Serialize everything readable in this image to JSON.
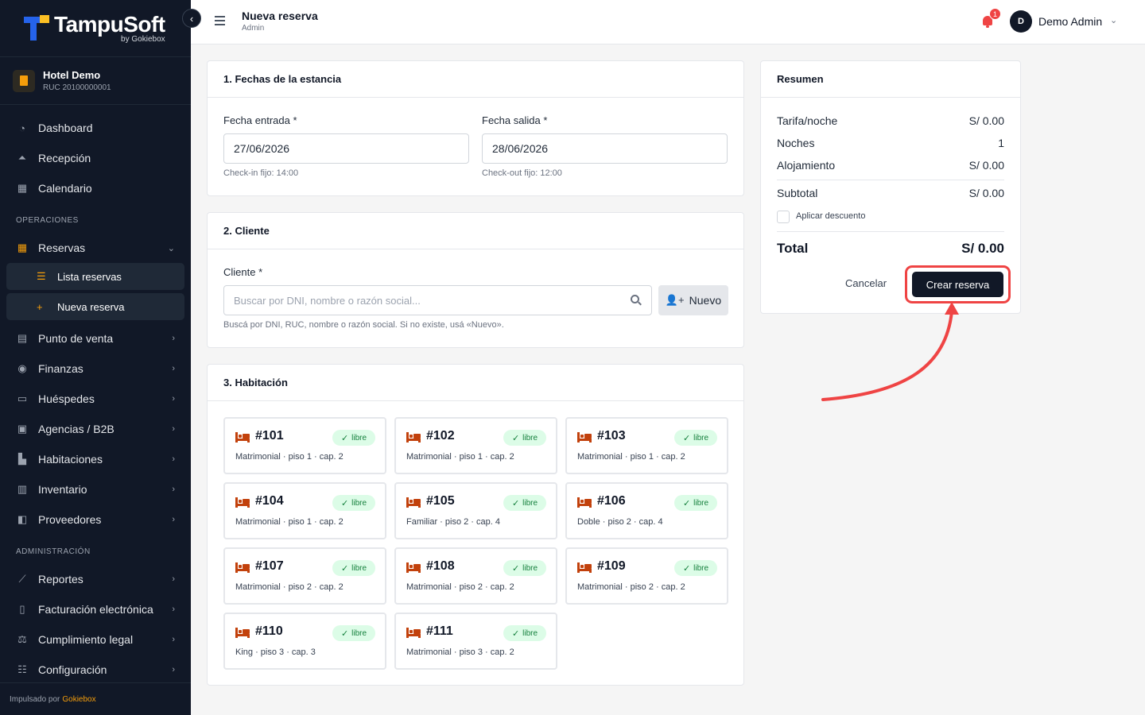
{
  "brand": {
    "name": "TampuSoft",
    "sub": "by Gokiebox"
  },
  "hotel": {
    "name": "Hotel Demo",
    "ruc": "RUC 20100000001"
  },
  "nav": {
    "dashboard": "Dashboard",
    "recepcion": "Recepción",
    "calendario": "Calendario",
    "section_operaciones": "OPERACIONES",
    "reservas": "Reservas",
    "lista_reservas": "Lista reservas",
    "nueva_reserva": "Nueva reserva",
    "punto_venta": "Punto de venta",
    "finanzas": "Finanzas",
    "huespedes": "Huéspedes",
    "agencias": "Agencias / B2B",
    "habitaciones": "Habitaciones",
    "inventario": "Inventario",
    "proveedores": "Proveedores",
    "section_admin": "ADMINISTRACIÓN",
    "reportes": "Reportes",
    "facturacion": "Facturación electrónica",
    "cumplimiento": "Cumplimiento legal",
    "configuracion": "Configuración"
  },
  "footer": {
    "prefix": "Impulsado por",
    "brand": "Gokiebox"
  },
  "topbar": {
    "title": "Nueva reserva",
    "subtitle": "Admin",
    "notifications": "1",
    "user_initial": "D",
    "user_name": "Demo Admin"
  },
  "fechas": {
    "heading": "1. Fechas de la estancia",
    "entrada_label": "Fecha entrada *",
    "entrada_value": "27/06/2026",
    "entrada_hint": "Check-in fijo: 14:00",
    "salida_label": "Fecha salida *",
    "salida_value": "28/06/2026",
    "salida_hint": "Check-out fijo: 12:00"
  },
  "cliente": {
    "heading": "2. Cliente",
    "label": "Cliente *",
    "placeholder": "Buscar por DNI, nombre o razón social...",
    "new_button": "Nuevo",
    "hint": "Buscá por DNI, RUC, nombre o razón social. Si no existe, usá «Nuevo»."
  },
  "habitacion": {
    "heading": "3. Habitación",
    "rooms": [
      {
        "number": "#101",
        "status": "libre",
        "info": "Matrimonial · piso 1 · cap. 2"
      },
      {
        "number": "#102",
        "status": "libre",
        "info": "Matrimonial · piso 1 · cap. 2"
      },
      {
        "number": "#103",
        "status": "libre",
        "info": "Matrimonial · piso 1 · cap. 2"
      },
      {
        "number": "#104",
        "status": "libre",
        "info": "Matrimonial · piso 1 · cap. 2"
      },
      {
        "number": "#105",
        "status": "libre",
        "info": "Familiar · piso 2 · cap. 4"
      },
      {
        "number": "#106",
        "status": "libre",
        "info": "Doble · piso 2 · cap. 4"
      },
      {
        "number": "#107",
        "status": "libre",
        "info": "Matrimonial · piso 2 · cap. 2"
      },
      {
        "number": "#108",
        "status": "libre",
        "info": "Matrimonial · piso 2 · cap. 2"
      },
      {
        "number": "#109",
        "status": "libre",
        "info": "Matrimonial · piso 2 · cap. 2"
      },
      {
        "number": "#110",
        "status": "libre",
        "info": "King · piso 3 · cap. 3"
      },
      {
        "number": "#111",
        "status": "libre",
        "info": "Matrimonial · piso 3 · cap. 2"
      }
    ]
  },
  "resumen": {
    "heading": "Resumen",
    "tarifa_label": "Tarifa/noche",
    "tarifa_value": "S/ 0.00",
    "noches_label": "Noches",
    "noches_value": "1",
    "alojamiento_label": "Alojamiento",
    "alojamiento_value": "S/ 0.00",
    "subtotal_label": "Subtotal",
    "subtotal_value": "S/ 0.00",
    "descuento_label": "Aplicar descuento",
    "total_label": "Total",
    "total_value": "S/ 0.00",
    "cancel_button": "Cancelar",
    "create_button": "Crear reserva"
  },
  "colors": {
    "sidebar_bg": "#111827",
    "accent": "#f59e0b",
    "primary_button": "#111827",
    "room_icon": "#c2410c",
    "status_libre_bg": "#dcfce7",
    "annotation": "#ef4444"
  }
}
